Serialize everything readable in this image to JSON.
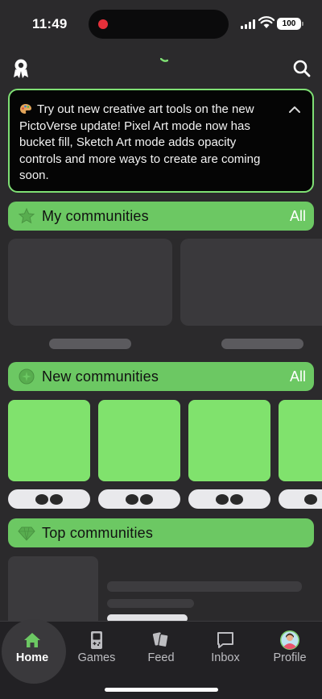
{
  "status_bar": {
    "time": "11:49",
    "battery": "100",
    "recording_color": "#e5303a"
  },
  "header": {
    "logo_icon": "ribbon-badge-icon",
    "search_icon": "search-icon"
  },
  "announcement": {
    "icon": "palette-icon",
    "text": "Try out new creative art tools on the new PictoVerse update! Pixel Art mode now has bucket fill, Sketch Art mode adds opacity controls and more ways to create are coming soon.",
    "collapse_icon": "chevron-up-icon"
  },
  "sections": {
    "my_communities": {
      "title": "My communities",
      "action": "All",
      "icon": "star-icon"
    },
    "new_communities": {
      "title": "New communities",
      "action": "All",
      "icon": "sparkle-icon"
    },
    "top_communities": {
      "title": "Top communities",
      "icon": "diamond-icon"
    }
  },
  "bottom_nav": {
    "items": [
      {
        "label": "Home",
        "icon": "home-icon",
        "active": true
      },
      {
        "label": "Games",
        "icon": "gameboy-icon",
        "active": false
      },
      {
        "label": "Feed",
        "icon": "cards-icon",
        "active": false
      },
      {
        "label": "Inbox",
        "icon": "chat-bubble-icon",
        "active": false
      },
      {
        "label": "Profile",
        "icon": "avatar-icon",
        "active": false
      }
    ]
  },
  "colors": {
    "accent": "#6cc863",
    "card_green": "#80e26d",
    "background": "#2b2a2c"
  }
}
